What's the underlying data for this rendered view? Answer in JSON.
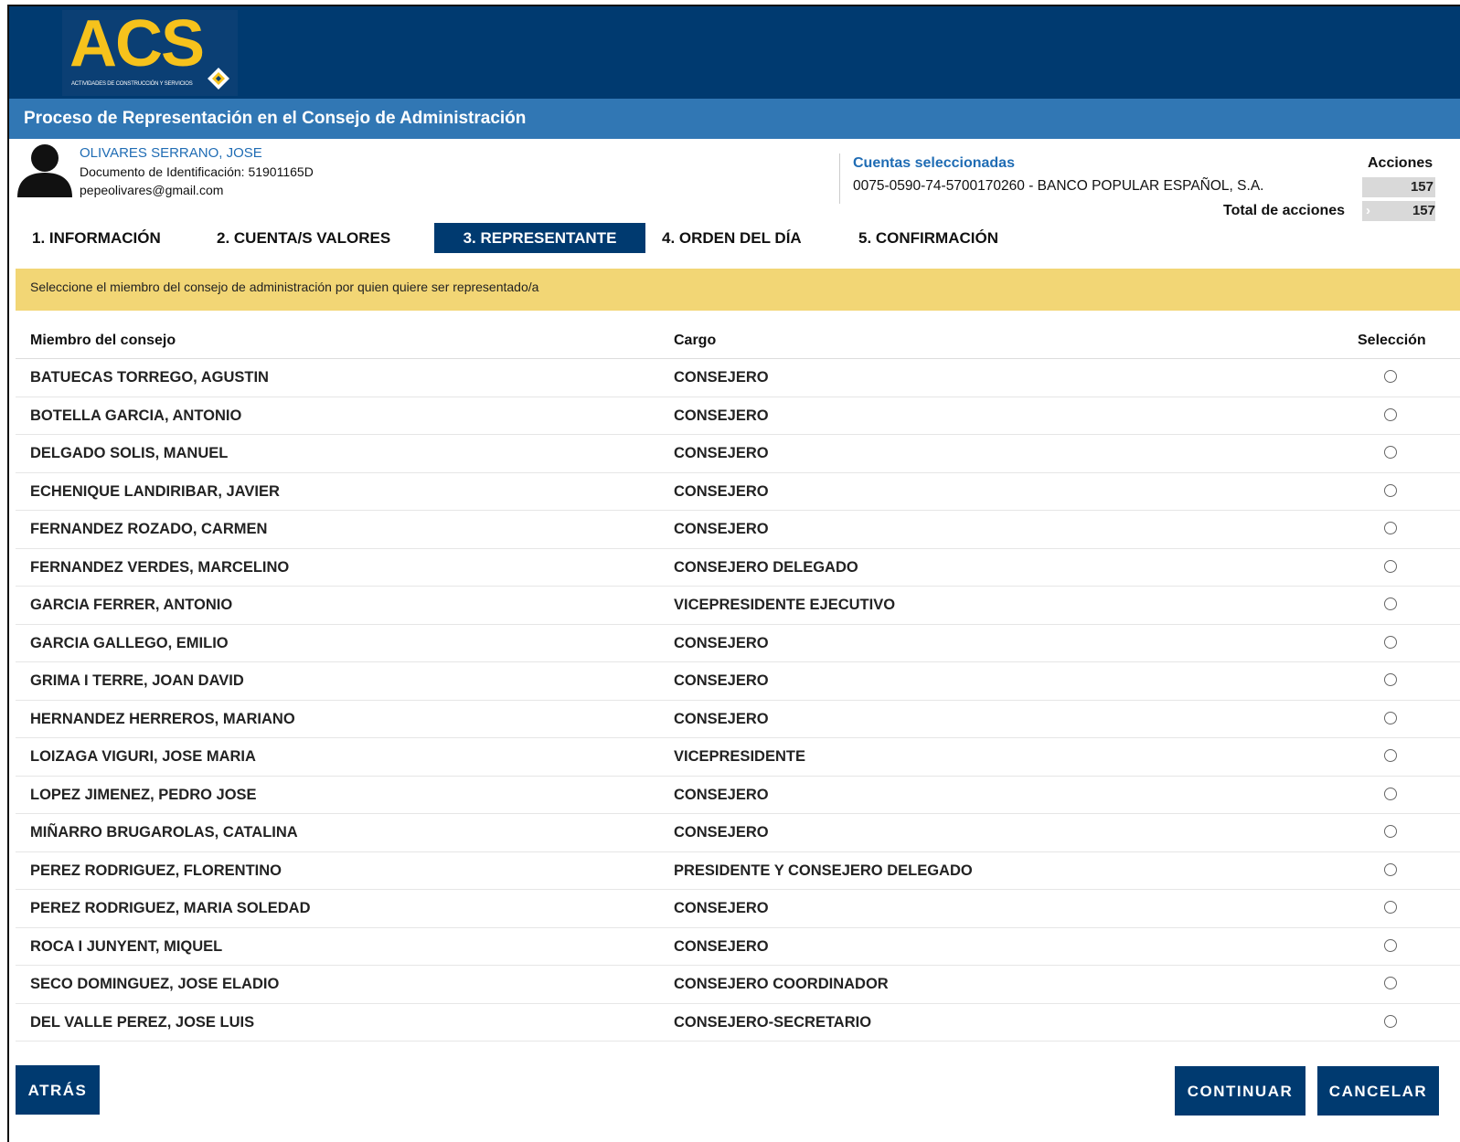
{
  "brand": {
    "logo_text": "ACS",
    "logo_subtitle": "ACTIVIDADES DE CONSTRUCCIÓN Y SERVICIOS",
    "logo_color": "#f6c21c",
    "header_color": "#003a70",
    "titlebar_color": "#3177b4"
  },
  "page_title": "Proceso de Representación en el Consejo de Administración",
  "user": {
    "name": "OLIVARES SERRANO, JOSE",
    "document": "Documento de Identificación: 51901165D",
    "email": "pepeolivares@gmail.com"
  },
  "accounts": {
    "title": "Cuentas seleccionadas",
    "account_number": "0075-0590-74-5700170260 - ",
    "bank": "BANCO POPULAR ESPAÑOL, S.A.",
    "shares_header": "Acciones",
    "shares_value": "157",
    "total_label": "Total de acciones",
    "total_value": "157"
  },
  "steps": [
    {
      "label": "1. INFORMACIÓN"
    },
    {
      "label": "2. CUENTA/S VALORES"
    },
    {
      "label": "3. REPRESENTANTE"
    },
    {
      "label": "4. ORDEN DEL DÍA"
    },
    {
      "label": "5. CONFIRMACIÓN"
    }
  ],
  "notice": "Seleccione el miembro del consejo de administración por quien quiere ser representado/a",
  "table": {
    "headers": {
      "member": "Miembro del consejo",
      "role": "Cargo",
      "selection": "Selección"
    },
    "rows": [
      {
        "member": "BATUECAS TORREGO, AGUSTIN",
        "role": "CONSEJERO"
      },
      {
        "member": "BOTELLA GARCIA, ANTONIO",
        "role": "CONSEJERO"
      },
      {
        "member": "DELGADO SOLIS, MANUEL",
        "role": "CONSEJERO"
      },
      {
        "member": "ECHENIQUE LANDIRIBAR, JAVIER",
        "role": "CONSEJERO"
      },
      {
        "member": "FERNANDEZ ROZADO, CARMEN",
        "role": "CONSEJERO"
      },
      {
        "member": "FERNANDEZ VERDES, MARCELINO",
        "role": "CONSEJERO DELEGADO"
      },
      {
        "member": "GARCIA FERRER, ANTONIO",
        "role": "VICEPRESIDENTE EJECUTIVO"
      },
      {
        "member": "GARCIA GALLEGO, EMILIO",
        "role": "CONSEJERO"
      },
      {
        "member": "GRIMA I TERRE, JOAN DAVID",
        "role": "CONSEJERO"
      },
      {
        "member": "HERNANDEZ HERREROS, MARIANO",
        "role": "CONSEJERO"
      },
      {
        "member": "LOIZAGA VIGURI, JOSE MARIA",
        "role": "VICEPRESIDENTE"
      },
      {
        "member": "LOPEZ JIMENEZ, PEDRO JOSE",
        "role": "CONSEJERO"
      },
      {
        "member": "MIÑARRO BRUGAROLAS, CATALINA",
        "role": "CONSEJERO"
      },
      {
        "member": "PEREZ RODRIGUEZ, FLORENTINO",
        "role": "PRESIDENTE Y CONSEJERO DELEGADO"
      },
      {
        "member": "PEREZ RODRIGUEZ, MARIA SOLEDAD",
        "role": "CONSEJERO"
      },
      {
        "member": "ROCA I JUNYENT, MIQUEL",
        "role": "CONSEJERO"
      },
      {
        "member": "SECO DOMINGUEZ, JOSE ELADIO",
        "role": "CONSEJERO COORDINADOR"
      },
      {
        "member": "DEL VALLE PEREZ, JOSE LUIS",
        "role": "CONSEJERO-SECRETARIO"
      }
    ]
  },
  "buttons": {
    "back": "ATRÁS",
    "continue": "CONTINUAR",
    "cancel": "CANCELAR"
  }
}
